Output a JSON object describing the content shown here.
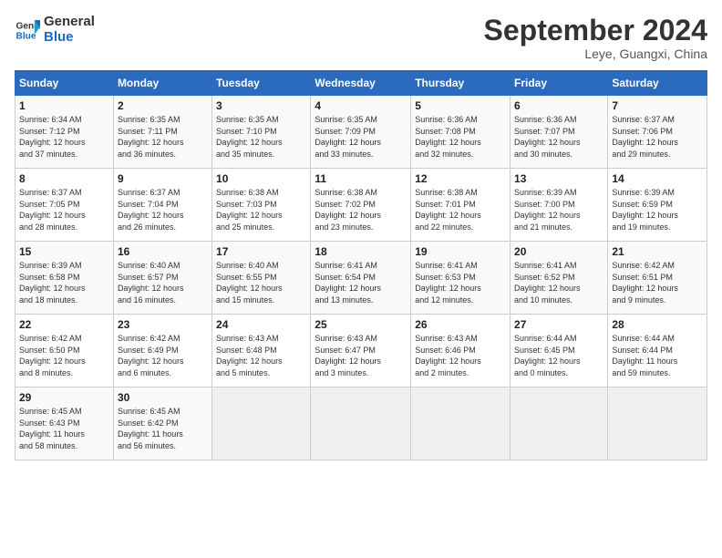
{
  "header": {
    "logo_line1": "General",
    "logo_line2": "Blue",
    "month": "September 2024",
    "location": "Leye, Guangxi, China"
  },
  "days_of_week": [
    "Sunday",
    "Monday",
    "Tuesday",
    "Wednesday",
    "Thursday",
    "Friday",
    "Saturday"
  ],
  "weeks": [
    [
      {
        "day": "1",
        "sunrise": "6:34 AM",
        "sunset": "7:12 PM",
        "daylight": "12 hours and 37 minutes."
      },
      {
        "day": "2",
        "sunrise": "6:35 AM",
        "sunset": "7:11 PM",
        "daylight": "12 hours and 36 minutes."
      },
      {
        "day": "3",
        "sunrise": "6:35 AM",
        "sunset": "7:10 PM",
        "daylight": "12 hours and 35 minutes."
      },
      {
        "day": "4",
        "sunrise": "6:35 AM",
        "sunset": "7:09 PM",
        "daylight": "12 hours and 33 minutes."
      },
      {
        "day": "5",
        "sunrise": "6:36 AM",
        "sunset": "7:08 PM",
        "daylight": "12 hours and 32 minutes."
      },
      {
        "day": "6",
        "sunrise": "6:36 AM",
        "sunset": "7:07 PM",
        "daylight": "12 hours and 30 minutes."
      },
      {
        "day": "7",
        "sunrise": "6:37 AM",
        "sunset": "7:06 PM",
        "daylight": "12 hours and 29 minutes."
      }
    ],
    [
      {
        "day": "8",
        "sunrise": "6:37 AM",
        "sunset": "7:05 PM",
        "daylight": "12 hours and 28 minutes."
      },
      {
        "day": "9",
        "sunrise": "6:37 AM",
        "sunset": "7:04 PM",
        "daylight": "12 hours and 26 minutes."
      },
      {
        "day": "10",
        "sunrise": "6:38 AM",
        "sunset": "7:03 PM",
        "daylight": "12 hours and 25 minutes."
      },
      {
        "day": "11",
        "sunrise": "6:38 AM",
        "sunset": "7:02 PM",
        "daylight": "12 hours and 23 minutes."
      },
      {
        "day": "12",
        "sunrise": "6:38 AM",
        "sunset": "7:01 PM",
        "daylight": "12 hours and 22 minutes."
      },
      {
        "day": "13",
        "sunrise": "6:39 AM",
        "sunset": "7:00 PM",
        "daylight": "12 hours and 21 minutes."
      },
      {
        "day": "14",
        "sunrise": "6:39 AM",
        "sunset": "6:59 PM",
        "daylight": "12 hours and 19 minutes."
      }
    ],
    [
      {
        "day": "15",
        "sunrise": "6:39 AM",
        "sunset": "6:58 PM",
        "daylight": "12 hours and 18 minutes."
      },
      {
        "day": "16",
        "sunrise": "6:40 AM",
        "sunset": "6:57 PM",
        "daylight": "12 hours and 16 minutes."
      },
      {
        "day": "17",
        "sunrise": "6:40 AM",
        "sunset": "6:55 PM",
        "daylight": "12 hours and 15 minutes."
      },
      {
        "day": "18",
        "sunrise": "6:41 AM",
        "sunset": "6:54 PM",
        "daylight": "12 hours and 13 minutes."
      },
      {
        "day": "19",
        "sunrise": "6:41 AM",
        "sunset": "6:53 PM",
        "daylight": "12 hours and 12 minutes."
      },
      {
        "day": "20",
        "sunrise": "6:41 AM",
        "sunset": "6:52 PM",
        "daylight": "12 hours and 10 minutes."
      },
      {
        "day": "21",
        "sunrise": "6:42 AM",
        "sunset": "6:51 PM",
        "daylight": "12 hours and 9 minutes."
      }
    ],
    [
      {
        "day": "22",
        "sunrise": "6:42 AM",
        "sunset": "6:50 PM",
        "daylight": "12 hours and 8 minutes."
      },
      {
        "day": "23",
        "sunrise": "6:42 AM",
        "sunset": "6:49 PM",
        "daylight": "12 hours and 6 minutes."
      },
      {
        "day": "24",
        "sunrise": "6:43 AM",
        "sunset": "6:48 PM",
        "daylight": "12 hours and 5 minutes."
      },
      {
        "day": "25",
        "sunrise": "6:43 AM",
        "sunset": "6:47 PM",
        "daylight": "12 hours and 3 minutes."
      },
      {
        "day": "26",
        "sunrise": "6:43 AM",
        "sunset": "6:46 PM",
        "daylight": "12 hours and 2 minutes."
      },
      {
        "day": "27",
        "sunrise": "6:44 AM",
        "sunset": "6:45 PM",
        "daylight": "12 hours and 0 minutes."
      },
      {
        "day": "28",
        "sunrise": "6:44 AM",
        "sunset": "6:44 PM",
        "daylight": "11 hours and 59 minutes."
      }
    ],
    [
      {
        "day": "29",
        "sunrise": "6:45 AM",
        "sunset": "6:43 PM",
        "daylight": "11 hours and 58 minutes."
      },
      {
        "day": "30",
        "sunrise": "6:45 AM",
        "sunset": "6:42 PM",
        "daylight": "11 hours and 56 minutes."
      },
      null,
      null,
      null,
      null,
      null
    ]
  ],
  "labels": {
    "sunrise": "Sunrise:",
    "sunset": "Sunset:",
    "daylight": "Daylight:"
  }
}
